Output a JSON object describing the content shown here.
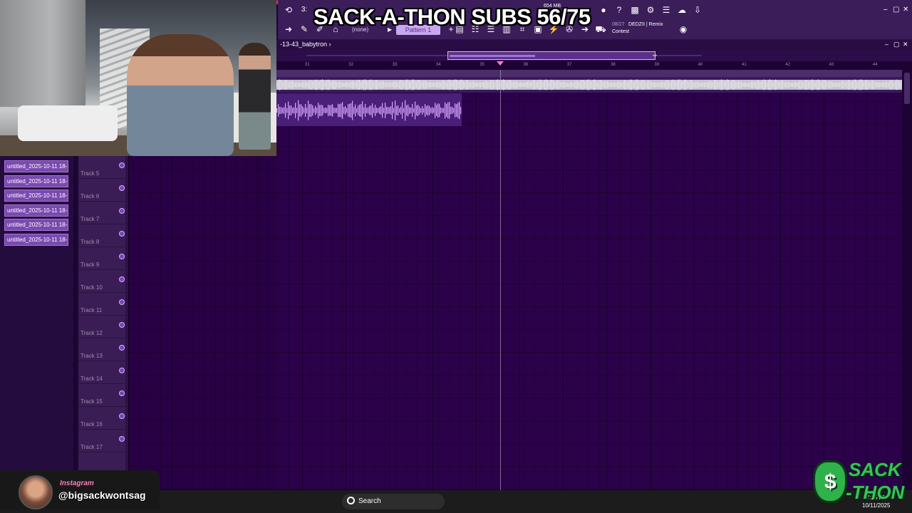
{
  "overlay": {
    "subs_title": "SACK-A-THON SUBS 56/75"
  },
  "toolbar": {
    "pattern": "Pattern 1",
    "none": "(none)",
    "memory": "654 MB",
    "song_number": "08/27",
    "song_name": "DEDZII | Remix",
    "song_sub": "Contest",
    "min": "–",
    "max": "▢",
    "close": "✕"
  },
  "playlist": {
    "title": "-13-43_babytron",
    "arrow": "›",
    "ruler": [
      "31",
      "32",
      "33",
      "34",
      "35",
      "36",
      "37",
      "38",
      "39",
      "40",
      "41",
      "42",
      "43",
      "44"
    ]
  },
  "browser": {
    "clips": [
      "untitled_2025-10-11 18-...",
      "untitled_2025-10-11 18-...",
      "untitled_2025-10-11 18-...",
      "untitled_2025-10-11 18-...",
      "untitled_2025-10-11 18-...",
      "untitled_2025-10-11 18-..."
    ]
  },
  "tracks": [
    "Track 5",
    "Track 6",
    "Track 7",
    "Track 8",
    "Track 9",
    "Track 10",
    "Track 11",
    "Track 12",
    "Track 13",
    "Track 14",
    "Track 15",
    "Track 16",
    "Track 17"
  ],
  "social": {
    "label": "Instagram",
    "handle": "@bigsackwontsag"
  },
  "taskbar": {
    "search": "Search",
    "time": "7:35 PM",
    "date": "10/11/2025"
  },
  "logo": {
    "line1": "SACK",
    "line2": "-THON",
    "symbol": "$"
  },
  "colors": {
    "accent": "#7a4aae",
    "grid": "#2b0249",
    "toolbar": "#3b1d5a",
    "logo_green": "#37c35a"
  }
}
